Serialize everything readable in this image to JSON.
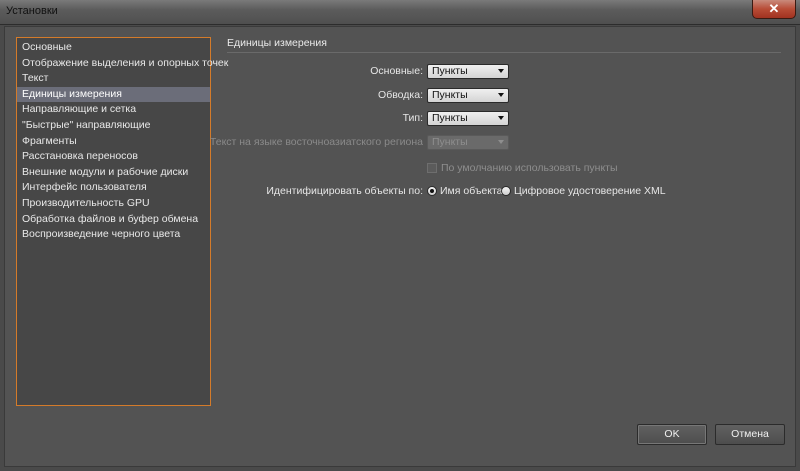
{
  "window": {
    "title": "Установки",
    "close_glyph": "✕"
  },
  "nav": {
    "items": [
      "Основные",
      "Отображение выделения и опорных точек",
      "Текст",
      "Единицы измерения",
      "Направляющие и сетка",
      "\"Быстрые\" направляющие",
      "Фрагменты",
      "Расстановка переносов",
      "Внешние модули и рабочие диски",
      "Интерфейс пользователя",
      "Производительность GPU",
      "Обработка файлов и буфер обмена",
      "Воспроизведение черного цвета"
    ],
    "selected_index": 3
  },
  "section": {
    "title": "Единицы измерения"
  },
  "fields": {
    "general": {
      "label": "Основные:",
      "value": "Пункты"
    },
    "stroke": {
      "label": "Обводка:",
      "value": "Пункты"
    },
    "type": {
      "label": "Тип:",
      "value": "Пункты"
    },
    "asian_type": {
      "label": "Текст на языке восточноазиатского региона",
      "value": "Пункты"
    }
  },
  "checkbox": {
    "label": "По умолчанию использовать пункты",
    "checked": false,
    "enabled": false
  },
  "identify": {
    "label": "Идентифицировать объекты по:",
    "options": [
      "Имя объекта",
      "Цифровое удостоверение XML"
    ],
    "selected_index": 0
  },
  "buttons": {
    "ok": "OK",
    "cancel": "Отмена"
  },
  "colors": {
    "focus_border": "#d47b2a",
    "selection": "#6b6d79"
  }
}
